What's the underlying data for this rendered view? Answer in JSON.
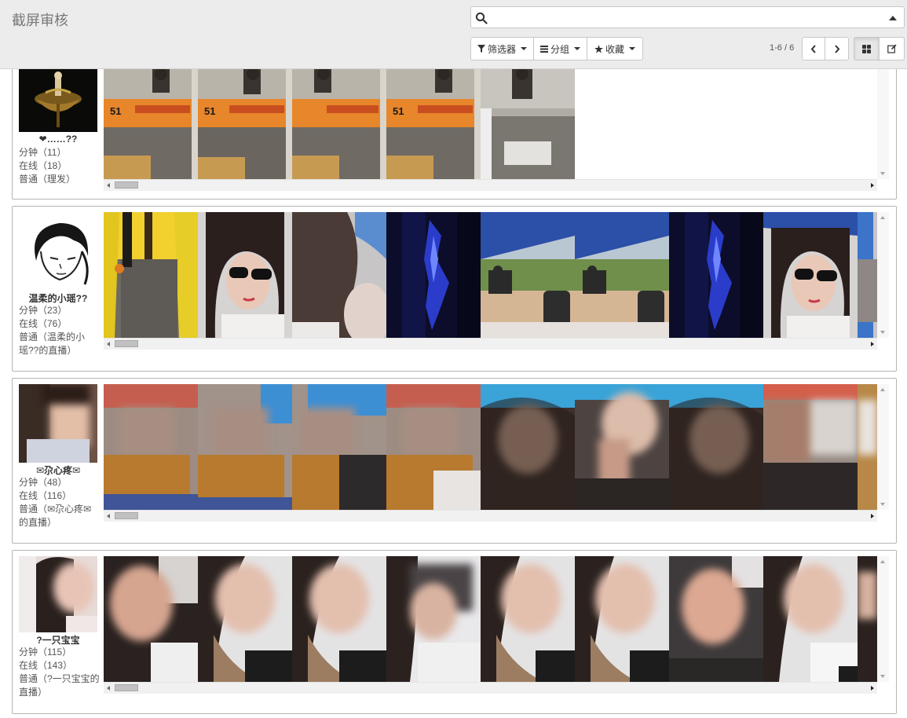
{
  "header": {
    "title": "截屏审核",
    "search_value": "",
    "filter_label": "筛选器",
    "group_label": "分组",
    "favorites_label": "收藏",
    "pagination": "1-6 / 6"
  },
  "colors": {
    "header_bg": "#ececec",
    "card_border": "#b5b5b5"
  },
  "streamers": [
    {
      "name": "❤……??",
      "minutes": "分钟（11）",
      "online": "在线（18）",
      "category": "普通（理发）",
      "thumbnail_count": 5,
      "thumbnail_subject": "barbershop scene with orange sign"
    },
    {
      "name": "温柔的小瑶??",
      "minutes": "分钟（23）",
      "online": "在线（76）",
      "category": "普通（温柔的小瑶??的直播）",
      "thumbnail_count": 9,
      "thumbnail_subject": "selfie with sunglasses, outdoor cart, dark blue"
    },
    {
      "name": "✉尕心疼✉",
      "minutes": "分钟（48）",
      "online": "在线（116）",
      "category": "普通（✉尕心疼✉的直播）",
      "thumbnail_count": 9,
      "thumbnail_subject": "pixelated faces"
    },
    {
      "name": "?一只宝宝",
      "minutes": "分钟（115）",
      "online": "在线（143）",
      "category": "普通（?一只宝宝的直播）",
      "thumbnail_count": 9,
      "thumbnail_subject": "pixelated selfies"
    }
  ]
}
